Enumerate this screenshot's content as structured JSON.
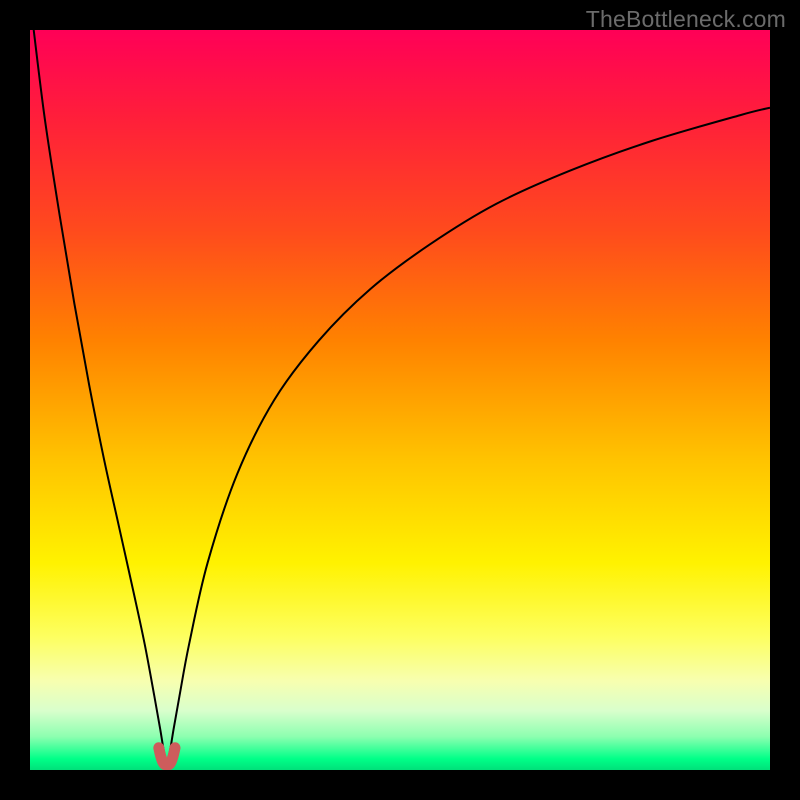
{
  "watermark": "TheBottleneck.com",
  "colors": {
    "frame": "#000000",
    "curve": "#000000",
    "marker": "#cd5c5c",
    "gradient_stops": [
      {
        "offset": 0.0,
        "color": "#ff0057"
      },
      {
        "offset": 0.12,
        "color": "#ff1f3a"
      },
      {
        "offset": 0.27,
        "color": "#ff4a1d"
      },
      {
        "offset": 0.42,
        "color": "#ff8200"
      },
      {
        "offset": 0.58,
        "color": "#ffc300"
      },
      {
        "offset": 0.72,
        "color": "#fff200"
      },
      {
        "offset": 0.82,
        "color": "#fdff60"
      },
      {
        "offset": 0.88,
        "color": "#f7ffb0"
      },
      {
        "offset": 0.92,
        "color": "#d9ffcc"
      },
      {
        "offset": 0.955,
        "color": "#8cffb0"
      },
      {
        "offset": 0.985,
        "color": "#00ff88"
      },
      {
        "offset": 1.0,
        "color": "#00e07a"
      }
    ]
  },
  "chart_data": {
    "type": "line",
    "title": "",
    "xlabel": "",
    "ylabel": "",
    "xlim": [
      0,
      100
    ],
    "ylim": [
      0,
      100
    ],
    "notch_x": 18.5,
    "series": [
      {
        "name": "bottleneck-curve",
        "x": [
          0.5,
          2,
          4,
          6,
          8,
          10,
          12,
          14,
          15.5,
          16.8,
          17.6,
          18.1,
          18.5,
          18.9,
          19.4,
          20.2,
          21.5,
          24,
          28,
          33,
          39,
          46,
          54,
          63,
          73,
          84,
          96,
          100
        ],
        "values": [
          100,
          88,
          75,
          63,
          52,
          42,
          33,
          24,
          17,
          10,
          5.5,
          2.5,
          1.2,
          2.5,
          5.5,
          10,
          17,
          28,
          40,
          50,
          58,
          65,
          71,
          76.5,
          81,
          85,
          88.5,
          89.5
        ]
      }
    ],
    "markers": [
      {
        "name": "notch-left",
        "x": 17.4,
        "y": 3.0
      },
      {
        "name": "notch-right",
        "x": 19.6,
        "y": 3.0
      }
    ]
  }
}
